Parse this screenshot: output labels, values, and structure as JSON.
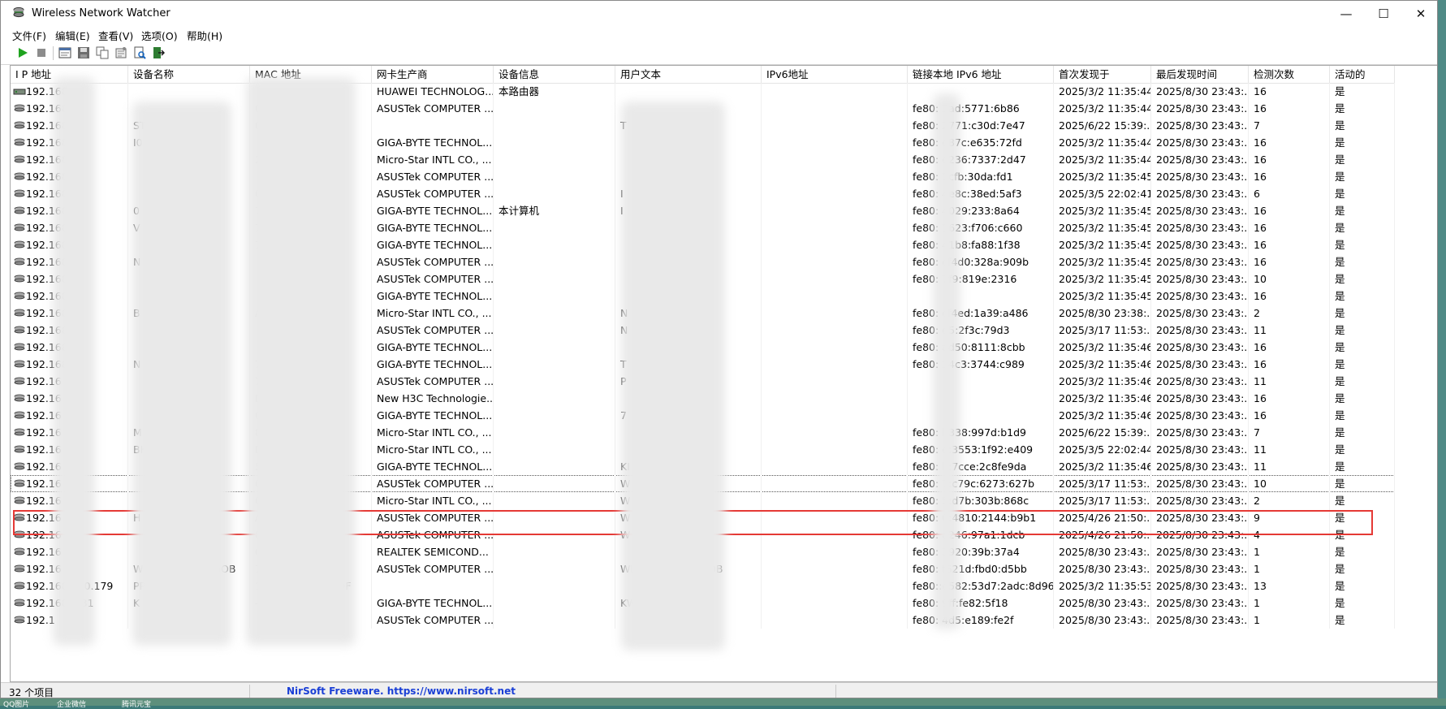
{
  "window": {
    "title": "Wireless Network Watcher",
    "minimize_glyph": "—",
    "maximize_glyph": "☐",
    "close_glyph": "✕"
  },
  "menu": [
    "文件(F)",
    "编辑(E)",
    "查看(V)",
    "选项(O)",
    "帮助(H)"
  ],
  "toolbar": {
    "icons": [
      "play-icon",
      "stop-icon",
      "html-report-icon",
      "save-icon",
      "copy-icon",
      "properties-icon",
      "find-icon",
      "exit-icon"
    ]
  },
  "columns": [
    "I P 地址",
    "设备名称",
    "MAC 地址",
    "网卡生产商",
    "设备信息",
    "用户文本",
    "IPv6地址",
    "链接本地 IPv6 地址",
    "首次发现于",
    "最后发现时间",
    "检测次数",
    "活动的"
  ],
  "rows": [
    {
      "ip": "192.168.",
      "name": "",
      "mac": "",
      "vendor": "HUAWEI TECHNOLOG...",
      "info": "本路由器",
      "user": "",
      "ipv6": "",
      "link": "",
      "first": "2025/3/2 11:35:44",
      "last": "2025/8/30 23:43:...",
      "count": "16",
      "active": "是"
    },
    {
      "ip": "192.168.",
      "name": "",
      "mac": "0",
      "vendor": "ASUSTek COMPUTER ...",
      "info": "",
      "user": "",
      "ipv6": "",
      "link": "fe80:   3ad:5771:6b86",
      "first": "2025/3/2 11:35:44",
      "last": "2025/8/30 23:43:...",
      "count": "16",
      "active": "是"
    },
    {
      "ip": "192.168.   4",
      "name": "           ST",
      "mac": "0",
      "vendor": "",
      "info": "",
      "user": "                T",
      "ipv6": "",
      "link": "fe80:   2771:c30d:7e47",
      "first": "2025/6/22 15:39:...",
      "last": "2025/8/30 23:43:...",
      "count": "7",
      "active": "是"
    },
    {
      "ip": "192.168.   5",
      "name": "           I0",
      "mac": "",
      "vendor": "GIGA-BYTE TECHNOL...",
      "info": "",
      "user": "",
      "ipv6": "",
      "link": "fe80:   e87c:e635:72fd",
      "first": "2025/3/2 11:35:44",
      "last": "2025/8/30 23:43:...",
      "count": "16",
      "active": "是"
    },
    {
      "ip": "192.168.   5",
      "name": "",
      "mac": "2",
      "vendor": "Micro-Star INTL CO., ...",
      "info": "",
      "user": "",
      "ipv6": "",
      "link": "fe80:   e236:7337:2d47",
      "first": "2025/3/2 11:35:44",
      "last": "2025/8/30 23:43:...",
      "count": "16",
      "active": "是"
    },
    {
      "ip": "192.168.   7",
      "name": "",
      "mac": "",
      "vendor": "ASUSTek COMPUTER ...",
      "info": "",
      "user": "",
      "ipv6": "",
      "link": "fe80:   1cfb:30da:fd1",
      "first": "2025/3/2 11:35:45",
      "last": "2025/8/30 23:43:...",
      "count": "16",
      "active": "是"
    },
    {
      "ip": "192.168.   3",
      "name": "",
      "mac": "0",
      "vendor": "ASUSTek COMPUTER ...",
      "info": "",
      "user": "I",
      "ipv6": "",
      "link": "fe80:   4e8c:38ed:5af3",
      "first": "2025/3/5 22:02:41",
      "last": "2025/8/30 23:43:...",
      "count": "6",
      "active": "是"
    },
    {
      "ip": "192.168.   9",
      "name": "           0",
      "mac": "74",
      "vendor": "GIGA-BYTE TECHNOL...",
      "info": "本计算机",
      "user": "I",
      "ipv6": "",
      "link": "fe80:   4029:233:8a64",
      "first": "2025/3/2 11:35:45",
      "last": "2025/8/30 23:43:...",
      "count": "16",
      "active": "是"
    },
    {
      "ip": "192.168.   0",
      "name": "           V",
      "mac": "74",
      "vendor": "GIGA-BYTE TECHNOL...",
      "info": "",
      "user": "",
      "ipv6": "",
      "link": "fe80:   1623:f706:c660",
      "first": "2025/3/2 11:35:45",
      "last": "2025/8/30 23:43:...",
      "count": "16",
      "active": "是"
    },
    {
      "ip": "192.168.   4",
      "name": "",
      "mac": "7",
      "vendor": "GIGA-BYTE TECHNOL...",
      "info": "",
      "user": "",
      "ipv6": "",
      "link": "fe80:   41b8:fa88:1f38",
      "first": "2025/3/2 11:35:45",
      "last": "2025/8/30 23:43:...",
      "count": "16",
      "active": "是"
    },
    {
      "ip": "192.168.   3",
      "name": "           N",
      "mac": "",
      "vendor": "ASUSTek COMPUTER ...",
      "info": "",
      "user": "",
      "ipv6": "",
      "link": "fe80:   cf4d0:328a:909b",
      "first": "2025/3/2 11:35:45",
      "last": "2025/8/30 23:43:...",
      "count": "16",
      "active": "是"
    },
    {
      "ip": "192.168.   7",
      "name": "",
      "mac": "",
      "vendor": "ASUSTek COMPUTER ...",
      "info": "",
      "user": "",
      "ipv6": "",
      "link": "fe80:   7f9:819e:2316",
      "first": "2025/3/2 11:35:45",
      "last": "2025/8/30 23:43:...",
      "count": "10",
      "active": "是"
    },
    {
      "ip": "192.168.   4",
      "name": "",
      "mac": "",
      "vendor": "GIGA-BYTE TECHNOL...",
      "info": "",
      "user": "",
      "ipv6": "",
      "link": "",
      "first": "2025/3/2 11:35:45",
      "last": "2025/8/30 23:43:...",
      "count": "16",
      "active": "是"
    },
    {
      "ip": "192.168.   0",
      "name": "B",
      "mac": "           A",
      "vendor": "Micro-Star INTL CO., ...",
      "info": "",
      "user": "                N",
      "ipv6": "",
      "link": "fe80:   cf4ed:1a39:a486",
      "first": "2025/8/30 23:38:...",
      "last": "2025/8/30 23:43:...",
      "count": "2",
      "active": "是"
    },
    {
      "ip": "192.168.   4",
      "name": "",
      "mac": "",
      "vendor": "ASUSTek COMPUTER ...",
      "info": "",
      "user": "                N",
      "ipv6": "",
      "link": "fe80:   d5:2f3c:79d3",
      "first": "2025/3/17 11:53:...",
      "last": "2025/8/30 23:43:...",
      "count": "11",
      "active": "是"
    },
    {
      "ip": "192.168   5",
      "name": "",
      "mac": "",
      "vendor": "GIGA-BYTE TECHNOL...",
      "info": "",
      "user": "",
      "ipv6": "",
      "link": "fe80:   ad50:8111:8cbb",
      "first": "2025/3/2 11:35:46",
      "last": "2025/8/30 23:43:...",
      "count": "16",
      "active": "是"
    },
    {
      "ip": "192.168   5",
      "name": "           N",
      "mac": "           7",
      "vendor": "GIGA-BYTE TECHNOL...",
      "info": "",
      "user": "                T",
      "ipv6": "",
      "link": "fe80:   14c3:3744:c989",
      "first": "2025/3/2 11:35:46",
      "last": "2025/8/30 23:43:...",
      "count": "16",
      "active": "是"
    },
    {
      "ip": "192.16",
      "name": "",
      "mac": "           7",
      "vendor": "ASUSTek COMPUTER ...",
      "info": "",
      "user": "                P",
      "ipv6": "",
      "link": "",
      "first": "2025/3/2 11:35:46",
      "last": "2025/8/30 23:43:...",
      "count": "11",
      "active": "是"
    },
    {
      "ip": "192.16",
      "name": "",
      "mac": "           B",
      "vendor": "New H3C Technologie...",
      "info": "",
      "user": "",
      "ipv6": "",
      "link": "",
      "first": "2025/3/2 11:35:46",
      "last": "2025/8/30 23:43:...",
      "count": "16",
      "active": "是"
    },
    {
      "ip": "192.16",
      "name": "",
      "mac": "           0",
      "vendor": "GIGA-BYTE TECHNOL...",
      "info": "",
      "user": "                7",
      "ipv6": "",
      "link": "",
      "first": "2025/3/2 11:35:46",
      "last": "2025/8/30 23:43:...",
      "count": "16",
      "active": "是"
    },
    {
      "ip": "192.16",
      "name": "           M",
      "mac": "           8",
      "vendor": "Micro-Star INTL CO., ...",
      "info": "",
      "user": "",
      "ipv6": "",
      "link": "fe80:   b338:997d:b1d9",
      "first": "2025/6/22 15:39:...",
      "last": "2025/8/30 23:43:...",
      "count": "7",
      "active": "是"
    },
    {
      "ip": "192.16",
      "name": "           BH",
      "mac": "           D",
      "vendor": "Micro-Star INTL CO., ...",
      "info": "",
      "user": "",
      "ipv6": "",
      "link": "fe80:   e:3553:1f92:e409",
      "first": "2025/3/5 22:02:44",
      "last": "2025/8/30 23:43:...",
      "count": "11",
      "active": "是"
    },
    {
      "ip": "192.16",
      "name": "",
      "mac": "           5",
      "vendor": "GIGA-BYTE TECHNOL...",
      "info": "",
      "user": "KI",
      "ipv6": "",
      "link": "fe80:   b:7cce:2c8fe9da",
      "first": "2025/3/2 11:35:46",
      "last": "2025/8/30 23:43:...",
      "count": "11",
      "active": "是"
    },
    {
      "ip": "192.16",
      "name": "",
      "mac": "0           D",
      "vendor": "ASUSTek COMPUTER ...",
      "info": "",
      "user": "W          C",
      "ipv6": "",
      "link": "fe80:   7:c79c:6273:627b",
      "first": "2025/3/17 11:53:...",
      "last": "2025/8/30 23:43:...",
      "count": "10",
      "active": "是"
    },
    {
      "ip": "192.16   3",
      "name": "",
      "mac": "0           55",
      "vendor": "Micro-Star INTL CO., ...",
      "info": "",
      "user": "W          3",
      "ipv6": "",
      "link": "fe80:   5:d7b:303b:868c",
      "first": "2025/3/17 11:53:...",
      "last": "2025/8/30 23:43:...",
      "count": "2",
      "active": "是"
    },
    {
      "ip": "192.16   0",
      "name": "           H",
      "mac": "A           F",
      "vendor": "ASUSTek COMPUTER ...",
      "info": "",
      "user": "W          H",
      "ipv6": "",
      "link": "fe80:   0:4810:2144:b9b1",
      "first": "2025/4/26 21:50:...",
      "last": "2025/8/30 23:43:...",
      "count": "9",
      "active": "是"
    },
    {
      "ip": "192.16   2",
      "name": "",
      "mac": "0           -C9",
      "vendor": "ASUSTek COMPUTER ...",
      "info": "",
      "user": "W          PC",
      "ipv6": "",
      "link": "fe80:   a246:97a1:1dcb",
      "first": "2025/4/26 21:50:...",
      "last": "2025/8/30 23:43:...",
      "count": "4",
      "active": "是"
    },
    {
      "ip": "192.16",
      "name": "",
      "mac": "           C3",
      "vendor": "REALTEK SEMICOND...",
      "info": "",
      "user": "",
      "ipv6": "",
      "link": "fe80:   3920:39b:37a4",
      "first": "2025/8/30 23:43:...",
      "last": "2025/8/30 23:43:...",
      "count": "1",
      "active": "是"
    },
    {
      "ip": "192.16   .87",
      "name": "WIN-CL4R29MHGOB",
      "mac": "           7A",
      "vendor": "ASUSTek COMPUTER ...",
      "info": "",
      "user": "WIN-CL4R29MHGOB",
      "ipv6": "",
      "link": "fe80:   f621d:fbd0:d5bb",
      "first": "2025/8/30 23:43:...",
      "last": "2025/8/30 23:43:...",
      "count": "1",
      "active": "是"
    },
    {
      "ip": "192.168.100.179",
      "name": "PPtech",
      "mac": "16-5A-91-5D-6F-9F",
      "vendor": "",
      "info": "",
      "user": "",
      "ipv6": "",
      "link": "fe80::e582:53d7:2adc:8d96",
      "first": "2025/3/2 11:35:53",
      "last": "2025/8/30 23:43:...",
      "count": "13",
      "active": "是"
    },
    {
      "ip": "192.168.   131",
      "name": "K",
      "mac": "           -18",
      "vendor": "GIGA-BYTE TECHNOL...",
      "info": "",
      "user": "KWRT",
      "ipv6": "",
      "link": "fe80:   9ff:fe82:5f18",
      "first": "2025/8/30 23:43:...",
      "last": "2025/8/30 23:43:...",
      "count": "1",
      "active": "是"
    },
    {
      "ip": "192.1",
      "name": "",
      "mac": "",
      "vendor": "ASUSTek COMPUTER ...",
      "info": "",
      "user": "",
      "ipv6": "",
      "link": "fe80:   4d5:e189:fe2f",
      "first": "2025/8/30 23:43:...",
      "last": "2025/8/30 23:43:...",
      "count": "1",
      "active": "是"
    }
  ],
  "status": {
    "count": "32 个项目",
    "link": "NirSoft Freeware. https://www.nirsoft.net"
  },
  "taskbar": [
    "QQ图片",
    "企业微信",
    "腾讯元宝"
  ]
}
